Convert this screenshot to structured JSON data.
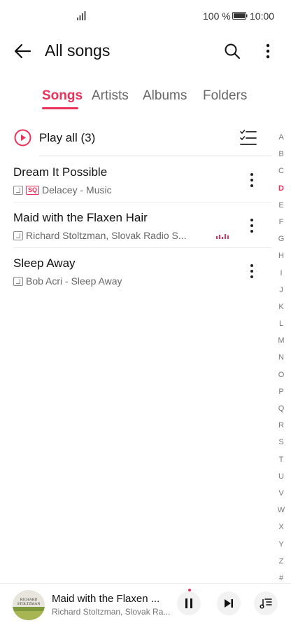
{
  "status_bar": {
    "battery": "100 %",
    "time": "10:00"
  },
  "header": {
    "title": "All songs"
  },
  "tabs": [
    {
      "label": "Songs",
      "active": true
    },
    {
      "label": "Artists",
      "active": false
    },
    {
      "label": "Albums",
      "active": false
    },
    {
      "label": "Folders",
      "active": false
    }
  ],
  "play_all": {
    "label": "Play all (3)"
  },
  "songs": [
    {
      "title": "Dream It Possible",
      "subtitle": "Delacey - Music",
      "badge": "SQ",
      "playing": false
    },
    {
      "title": "Maid with the Flaxen Hair",
      "subtitle": "Richard Stoltzman, Slovak Radio S...",
      "badge": "",
      "playing": true
    },
    {
      "title": "Sleep Away",
      "subtitle": "Bob Acri - Sleep Away",
      "badge": "",
      "playing": false
    }
  ],
  "alphabet_index": {
    "letters": [
      "A",
      "B",
      "C",
      "D",
      "E",
      "F",
      "G",
      "H",
      "I",
      "J",
      "K",
      "L",
      "M",
      "N",
      "O",
      "P",
      "Q",
      "R",
      "S",
      "T",
      "U",
      "V",
      "W",
      "X",
      "Y",
      "Z",
      "#"
    ],
    "current": "D"
  },
  "now_playing": {
    "title": "Maid with the Flaxen ...",
    "artist": "Richard Stoltzman, Slovak Ra...",
    "album_art_text": "RICHARD STOLTZMAN"
  },
  "colors": {
    "accent": "#e8325a",
    "text": "#111111",
    "secondary": "#666666"
  },
  "icons": {
    "back": "arrow-left-icon",
    "search": "search-icon",
    "more": "more-vertical-icon",
    "play_all": "play-circle-icon",
    "multiselect": "checklist-icon",
    "pause": "pause-icon",
    "next": "skip-next-icon",
    "queue": "playlist-icon"
  }
}
